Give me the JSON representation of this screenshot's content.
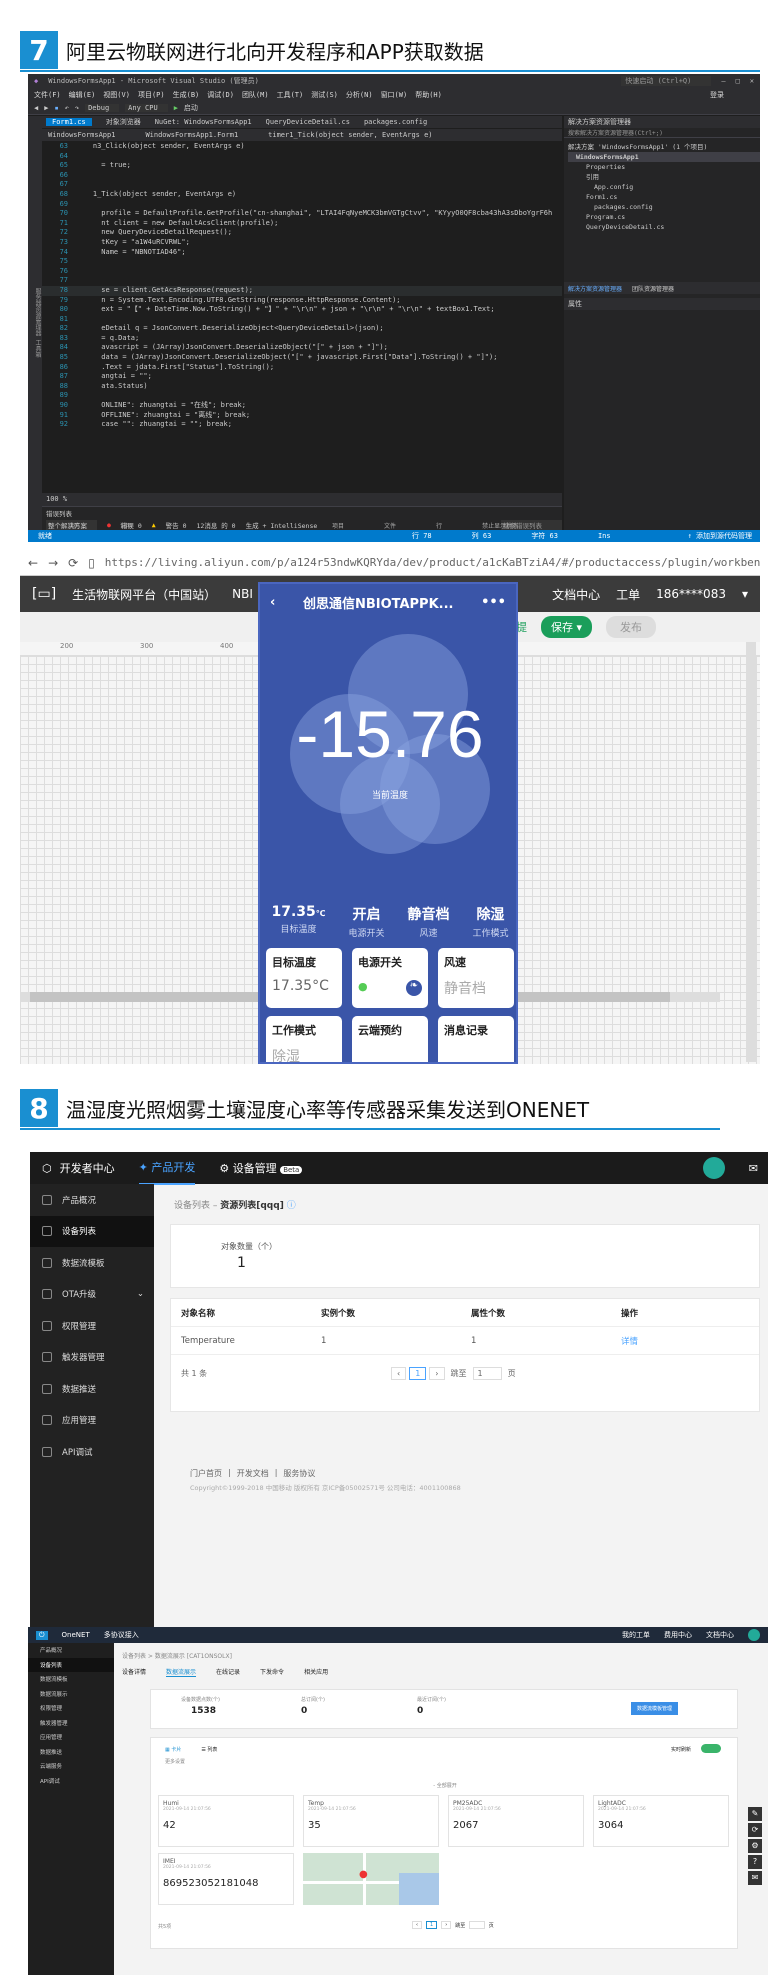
{
  "section7": {
    "num": "7",
    "title": "阿里云物联网进行北向开发程序和APP获取数据"
  },
  "vs": {
    "window_title": "WindowsFormsApp1 - Microsoft Visual Studio (管理员)",
    "quick_launch": "快速启动 (Ctrl+Q)",
    "login": "登录",
    "menu": [
      "文件(F)",
      "编辑(E)",
      "视图(V)",
      "项目(P)",
      "生成(B)",
      "调试(D)",
      "团队(M)",
      "工具(T)",
      "测试(S)",
      "分析(N)",
      "窗口(W)",
      "帮助(H)"
    ],
    "toolbar_debug": "Debug",
    "toolbar_cpu": "Any CPU",
    "toolbar_start": "启动",
    "tabs": [
      "Form1.cs",
      "对象浏览器",
      "NuGet: WindowsFormsApp1",
      "QueryDeviceDetail.cs",
      "packages.config"
    ],
    "nav_left": "WindowsFormsApp1",
    "nav_mid": "WindowsFormsApp1.Form1",
    "nav_right": "timer1_Tick(object sender, EventArgs e)",
    "code": [
      {
        "n": "63",
        "t": "    n3_Click(object sender, EventArgs e)"
      },
      {
        "n": "64",
        "t": ""
      },
      {
        "n": "65",
        "t": "      = true;"
      },
      {
        "n": "66",
        "t": ""
      },
      {
        "n": "67",
        "t": ""
      },
      {
        "n": "68",
        "t": "    1_Tick(object sender, EventArgs e)"
      },
      {
        "n": "69",
        "t": ""
      },
      {
        "n": "70",
        "t": "      profile = DefaultProfile.GetProfile(\"cn-shanghai\", \"LTAI4FqNyeMCK3bmVGTgCtvv\", \"KYyyO0QF8cba43hA3sDboYgrF6h"
      },
      {
        "n": "71",
        "t": "      nt client = new DefaultAcsClient(profile);"
      },
      {
        "n": "72",
        "t": "      new QueryDeviceDetailRequest();"
      },
      {
        "n": "73",
        "t": "      tKey = \"a1W4uRCVRWL\";"
      },
      {
        "n": "74",
        "t": "      Name = \"NBNOTIAD46\";"
      },
      {
        "n": "75",
        "t": ""
      },
      {
        "n": "76",
        "t": ""
      },
      {
        "n": "77",
        "t": ""
      },
      {
        "n": "78",
        "t": "      se = client.GetAcsResponse(request);"
      },
      {
        "n": "79",
        "t": "      n = System.Text.Encoding.UTF8.GetString(response.HttpResponse.Content);"
      },
      {
        "n": "80",
        "t": "      ext = \"【\" + DateTime.Now.ToString() + \"】\" + \"\\r\\n\" + json + \"\\r\\n\" + \"\\r\\n\" + textBox1.Text;"
      },
      {
        "n": "81",
        "t": ""
      },
      {
        "n": "82",
        "t": "      eDetail q = JsonConvert.DeserializeObject<QueryDeviceDetail>(json);"
      },
      {
        "n": "83",
        "t": "      = q.Data;"
      },
      {
        "n": "84",
        "t": "      avascript = (JArray)JsonConvert.DeserializeObject(\"[\" + json + \"]\");"
      },
      {
        "n": "85",
        "t": "      data = (JArray)JsonConvert.DeserializeObject(\"[\" + javascript.First[\"Data\"].ToString() + \"]\");"
      },
      {
        "n": "86",
        "t": "      .Text = jdata.First[\"Status\"].ToString();"
      },
      {
        "n": "87",
        "t": "      angtai = \"\";"
      },
      {
        "n": "88",
        "t": "      ata.Status)"
      },
      {
        "n": "89",
        "t": ""
      },
      {
        "n": "90",
        "t": "      ONLINE\": zhuangtai = \"在线\"; break;"
      },
      {
        "n": "91",
        "t": "      OFFLINE\": zhuangtai = \"离线\"; break;"
      },
      {
        "n": "92",
        "t": "      case \"\": zhuangtai = \"\"; break;"
      }
    ],
    "zoom": "100 %",
    "error_title": "错误列表",
    "error_scope": "整个解决方案",
    "errors": "错误 0",
    "warnings": "警告 0",
    "messages": "12消息 的 0",
    "build": "生成 + IntelliSense",
    "search_errors": "搜索错误列表",
    "err_cols": [
      "代码",
      "说明",
      "项目",
      "文件",
      "行",
      "禁止显示状态"
    ],
    "sol_title": "解决方案资源管理器",
    "sol_search": "搜索解决方案资源管理器(Ctrl+;)",
    "sol_items": [
      "解决方案 'WindowsFormsApp1' (1 个项目)",
      "WindowsFormsApp1",
      "Properties",
      "引用",
      "App.config",
      "Form1.cs",
      "packages.config",
      "Program.cs",
      "QueryDeviceDetail.cs"
    ],
    "sol_tabs": [
      "解决方案资源管理器",
      "团队资源管理器"
    ],
    "props_title": "属性",
    "status": [
      "就绪",
      "行 78",
      "列 63",
      "字符 63",
      "Ins"
    ],
    "status_right": "↑ 添加到源代码管理"
  },
  "browser": {
    "url": "https://living.aliyun.com/p/a124r53ndwKQRYda/dev/product/a1cKaBTziA4/#/productaccess/plugin/workbench/edit",
    "nav_title": "生活物联网平台（中国站）",
    "nav_nb": "NBI",
    "doc": "文档中心",
    "work": "工单",
    "account": "186****083",
    "save": "保存",
    "publish": "发布",
    "hint": "提",
    "ruler": [
      "200",
      "300",
      "400"
    ],
    "phone": {
      "title": "创思通信NBIOTAPPK...",
      "temp": "-15.76",
      "temp_label": "当前温度",
      "stats": [
        {
          "v": "17.35",
          "u": "℃",
          "l": "目标温度"
        },
        {
          "v": "开启",
          "u": "",
          "l": "电源开关"
        },
        {
          "v": "静音档",
          "u": "",
          "l": "风速"
        },
        {
          "v": "除湿",
          "u": "",
          "l": "工作模式"
        }
      ],
      "cards": [
        {
          "t": "目标温度",
          "v": "17.35°C"
        },
        {
          "t": "电源开关",
          "v": ""
        },
        {
          "t": "风速",
          "v": "静音档"
        },
        {
          "t": "工作模式",
          "v": "除湿"
        },
        {
          "t": "云端预约",
          "v": ""
        },
        {
          "t": "消息记录",
          "v": ""
        }
      ]
    }
  },
  "section8": {
    "num": "8",
    "title": "温湿度光照烟雾土壤湿度心率等传感器采集发送到ONENET"
  },
  "onenet1": {
    "brand": "开发者中心",
    "top_tabs": [
      "产品开发",
      "设备管理"
    ],
    "beta": "Beta",
    "side": [
      "产品概况",
      "设备列表",
      "数据流模板",
      "OTA升级",
      "权限管理",
      "触发器管理",
      "数据推送",
      "应用管理",
      "API调试"
    ],
    "breadcrumb_a": "设备列表",
    "breadcrumb_b": "资源列表[qqq]",
    "count_label": "对象数量（个）",
    "count": "1",
    "cols": [
      "对象名称",
      "实例个数",
      "属性个数",
      "操作"
    ],
    "row": [
      "Temperature",
      "1",
      "1",
      "详情"
    ],
    "total": "共 1 条",
    "page": "1",
    "jump": "跳至",
    "jump_val": "1",
    "page_unit": "页",
    "footer_links": [
      "门户首页",
      "开发文档",
      "服务协议"
    ],
    "copyright": "Copyright©1999-2018 中国移动 版权所有 京ICP备05002571号 公司电话：4001100868"
  },
  "onenet2": {
    "brand": "OneNET",
    "product": "多协议接入",
    "top_right": [
      "我的工单",
      "费用中心",
      "文档中心"
    ],
    "side": [
      "产品概况",
      "设备列表",
      "数据流模板",
      "数据流展示",
      "权限管理",
      "触发器管理",
      "应用管理",
      "数据推送",
      "云端服务",
      "API调试"
    ],
    "breadcrumb": "设备列表 > 数据流展示 [CAT1ONSOLX]",
    "tabs": [
      "设备详情",
      "数据流展示",
      "在线记录",
      "下发命令",
      "相关应用"
    ],
    "stats": [
      {
        "l": "设备数据点数(个)",
        "v": "1538"
      },
      {
        "l": "总订阅(个)",
        "v": "0"
      },
      {
        "l": "最近订阅(个)",
        "v": "0"
      }
    ],
    "btn": "数据流模板管理",
    "view_tabs": [
      "卡片",
      "列表"
    ],
    "realtime": "实时刷新",
    "sub": "更多设置",
    "collapse": "- 全部展开",
    "sensors": [
      {
        "n": "Humi",
        "t": "2021-09-14 21:07:56",
        "v": "42"
      },
      {
        "n": "Temp",
        "t": "2021-09-14 21:07:56",
        "v": "35"
      },
      {
        "n": "PM25ADC",
        "t": "2021-09-14 21:07:56",
        "v": "2067"
      },
      {
        "n": "LightADC",
        "t": "2021-09-14 21:07:56",
        "v": "3064"
      },
      {
        "n": "IMEI",
        "t": "2021-09-14 21:07:56",
        "v": "869523052181048"
      }
    ],
    "total": "共5项",
    "page": "1",
    "jump": "跳至",
    "unit": "页"
  }
}
